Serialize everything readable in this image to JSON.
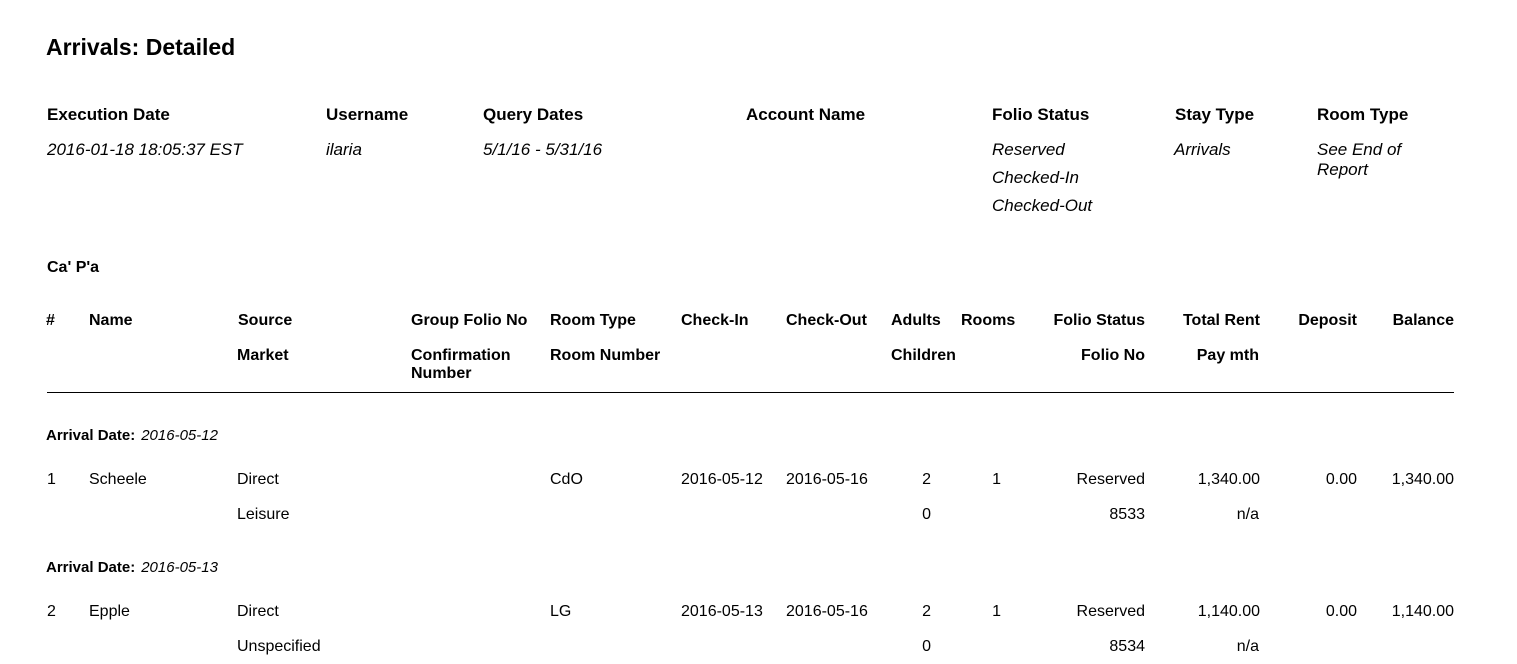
{
  "report": {
    "title": "Arrivals: Detailed"
  },
  "meta": {
    "execution_date_label": "Execution Date",
    "execution_date": "2016-01-18 18:05:37 EST",
    "username_label": "Username",
    "username": "ilaria",
    "query_dates_label": "Query Dates",
    "query_dates": "5/1/16 - 5/31/16",
    "account_name_label": "Account Name",
    "account_name": "",
    "folio_status_label": "Folio Status",
    "folio_statuses": [
      "Reserved",
      "Checked-In",
      "Checked-Out"
    ],
    "stay_type_label": "Stay Type",
    "stay_type": "Arrivals",
    "room_type_label": "Room Type",
    "room_type": "See End of Report"
  },
  "property": {
    "name": "Ca' P'a"
  },
  "columns": {
    "num": "#",
    "name": "Name",
    "source": "Source",
    "market": "Market",
    "group_folio_no": "Group Folio No",
    "confirmation_number": "Confirmation Number",
    "room_type": "Room Type",
    "room_number": "Room Number",
    "check_in": "Check-In",
    "check_out": "Check-Out",
    "adults": "Adults",
    "children": "Children",
    "rooms": "Rooms",
    "folio_status": "Folio Status",
    "folio_no": "Folio No",
    "total_rent": "Total Rent",
    "pay_mth": "Pay mth",
    "deposit": "Deposit",
    "balance": "Balance"
  },
  "groups": [
    {
      "label": "Arrival Date:",
      "date": "2016-05-12",
      "rows": [
        {
          "num": "1",
          "name": "Scheele",
          "source": "Direct",
          "market": "Leisure",
          "room_type": "CdO",
          "check_in": "2016-05-12",
          "check_out": "2016-05-16",
          "adults": "2",
          "children": "0",
          "rooms": "1",
          "folio_status": "Reserved",
          "folio_no": "8533",
          "total_rent": "1,340.00",
          "pay_mth": "n/a",
          "deposit": "0.00",
          "balance": "1,340.00"
        }
      ]
    },
    {
      "label": "Arrival Date:",
      "date": "2016-05-13",
      "rows": [
        {
          "num": "2",
          "name": "Epple",
          "source": "Direct",
          "market": "Unspecified",
          "room_type": "LG",
          "check_in": "2016-05-13",
          "check_out": "2016-05-16",
          "adults": "2",
          "children": "0",
          "rooms": "1",
          "folio_status": "Reserved",
          "folio_no": "8534",
          "total_rent": "1,140.00",
          "pay_mth": "n/a",
          "deposit": "0.00",
          "balance": "1,140.00"
        }
      ]
    }
  ]
}
